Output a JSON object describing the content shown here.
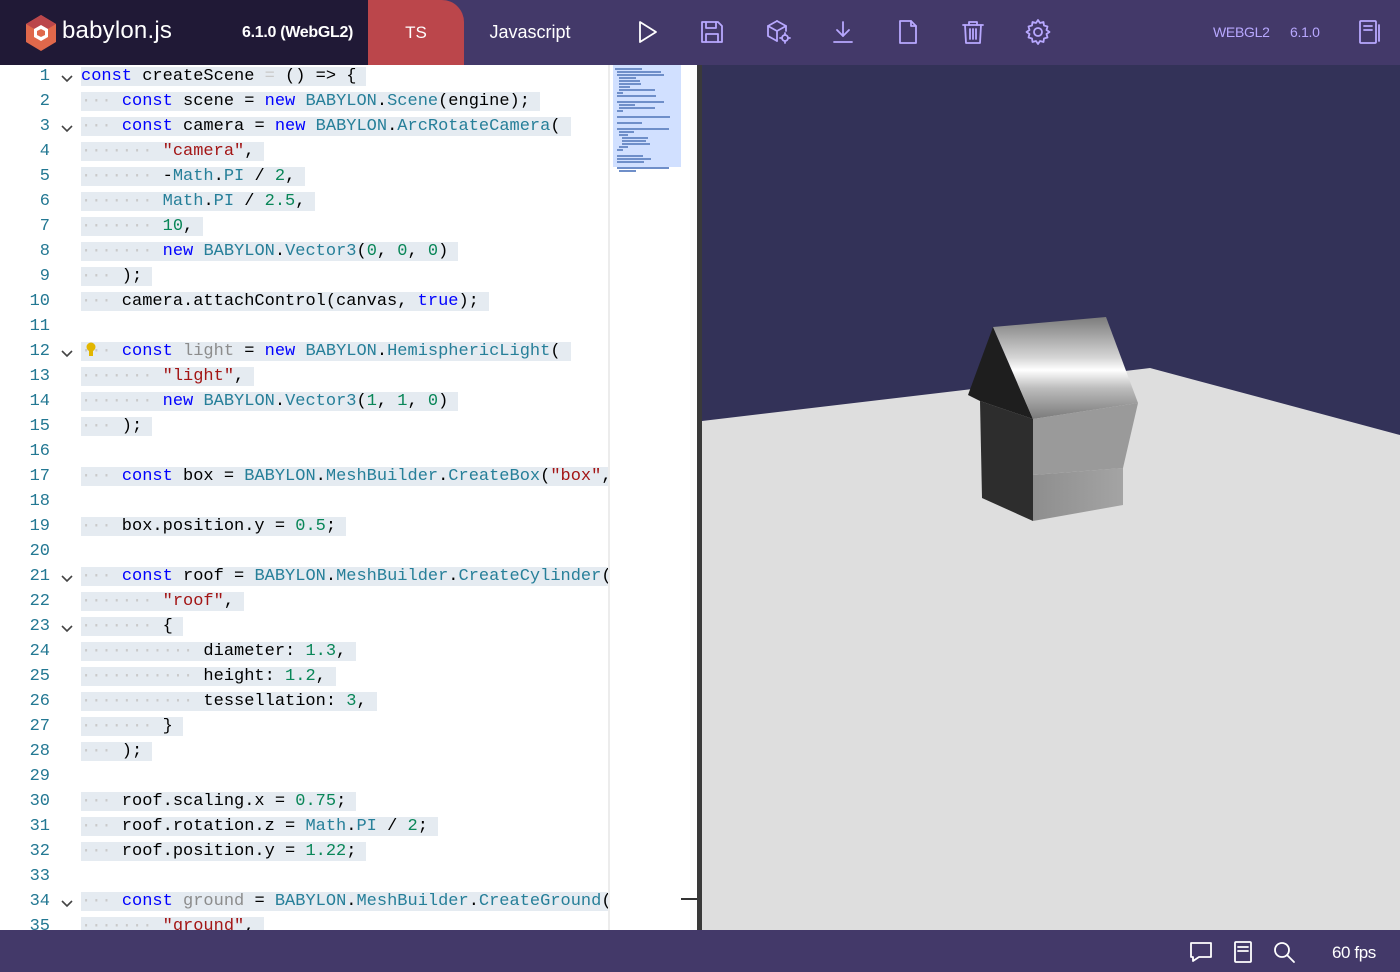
{
  "header": {
    "logo_text": "babylon.js",
    "version_label": "6.1.0 (WebGL2)",
    "tab_ts": "TS",
    "tab_js": "Javascript",
    "engine_label": "WEBGL2",
    "engine_version": "6.1.0",
    "icons": [
      "play-icon",
      "save-icon",
      "inspector-icon",
      "download-icon",
      "new-file-icon",
      "delete-icon",
      "settings-icon",
      "examples-icon"
    ]
  },
  "editor": {
    "line_numbers": [
      "1",
      "2",
      "3",
      "4",
      "5",
      "6",
      "7",
      "8",
      "9",
      "10",
      "11",
      "12",
      "13",
      "14",
      "15",
      "16",
      "17",
      "18",
      "19",
      "20",
      "21",
      "22",
      "23",
      "24",
      "25",
      "26",
      "27",
      "28",
      "29",
      "30",
      "31",
      "32",
      "33",
      "34",
      "35"
    ],
    "folded_lines": [
      1,
      3,
      12,
      21,
      23,
      34
    ],
    "lines": [
      [
        [
          "k",
          "const"
        ],
        [
          "p",
          " createScene "
        ],
        [
          "ws",
          "="
        ],
        [
          "p",
          " () => {"
        ]
      ],
      [
        [
          "ws",
          "···"
        ],
        [
          "p",
          " "
        ],
        [
          "k",
          "const"
        ],
        [
          "p",
          " scene = "
        ],
        [
          "k",
          "new"
        ],
        [
          "p",
          " "
        ],
        [
          "t",
          "BABYLON"
        ],
        [
          "p",
          "."
        ],
        [
          "t",
          "Scene"
        ],
        [
          "p",
          "(engine);"
        ]
      ],
      [
        [
          "ws",
          "···"
        ],
        [
          "p",
          " "
        ],
        [
          "k",
          "const"
        ],
        [
          "p",
          " camera = "
        ],
        [
          "k",
          "new"
        ],
        [
          "p",
          " "
        ],
        [
          "t",
          "BABYLON"
        ],
        [
          "p",
          "."
        ],
        [
          "t",
          "ArcRotateCamera"
        ],
        [
          "p",
          "("
        ]
      ],
      [
        [
          "ws",
          "·······"
        ],
        [
          "p",
          " "
        ],
        [
          "s",
          "\"camera\""
        ],
        [
          "p",
          ","
        ]
      ],
      [
        [
          "ws",
          "·······"
        ],
        [
          "p",
          " -"
        ],
        [
          "t",
          "Math"
        ],
        [
          "p",
          "."
        ],
        [
          "t",
          "PI"
        ],
        [
          "p",
          " / "
        ],
        [
          "n",
          "2"
        ],
        [
          "p",
          ","
        ]
      ],
      [
        [
          "ws",
          "·······"
        ],
        [
          "p",
          " "
        ],
        [
          "t",
          "Math"
        ],
        [
          "p",
          "."
        ],
        [
          "t",
          "PI"
        ],
        [
          "p",
          " / "
        ],
        [
          "n",
          "2.5"
        ],
        [
          "p",
          ","
        ]
      ],
      [
        [
          "ws",
          "·······"
        ],
        [
          "p",
          " "
        ],
        [
          "n",
          "10"
        ],
        [
          "p",
          ","
        ]
      ],
      [
        [
          "ws",
          "·······"
        ],
        [
          "p",
          " "
        ],
        [
          "k",
          "new"
        ],
        [
          "p",
          " "
        ],
        [
          "t",
          "BABYLON"
        ],
        [
          "p",
          "."
        ],
        [
          "t",
          "Vector3"
        ],
        [
          "p",
          "("
        ],
        [
          "n",
          "0"
        ],
        [
          "p",
          ", "
        ],
        [
          "n",
          "0"
        ],
        [
          "p",
          ", "
        ],
        [
          "n",
          "0"
        ],
        [
          "p",
          ")"
        ]
      ],
      [
        [
          "ws",
          "···"
        ],
        [
          "p",
          " );"
        ]
      ],
      [
        [
          "ws",
          "···"
        ],
        [
          "p",
          " camera.attachControl(canvas, "
        ],
        [
          "k",
          "true"
        ],
        [
          "p",
          ");"
        ]
      ],
      [],
      [
        [
          "ws",
          "···"
        ],
        [
          "p",
          " "
        ],
        [
          "k",
          "const"
        ],
        [
          "p",
          " "
        ],
        [
          "dim",
          "light"
        ],
        [
          "p",
          " = "
        ],
        [
          "k",
          "new"
        ],
        [
          "p",
          " "
        ],
        [
          "t",
          "BABYLON"
        ],
        [
          "p",
          "."
        ],
        [
          "t",
          "HemisphericLight"
        ],
        [
          "p",
          "("
        ]
      ],
      [
        [
          "ws",
          "·······"
        ],
        [
          "p",
          " "
        ],
        [
          "s",
          "\"light\""
        ],
        [
          "p",
          ","
        ]
      ],
      [
        [
          "ws",
          "·······"
        ],
        [
          "p",
          " "
        ],
        [
          "k",
          "new"
        ],
        [
          "p",
          " "
        ],
        [
          "t",
          "BABYLON"
        ],
        [
          "p",
          "."
        ],
        [
          "t",
          "Vector3"
        ],
        [
          "p",
          "("
        ],
        [
          "n",
          "1"
        ],
        [
          "p",
          ", "
        ],
        [
          "n",
          "1"
        ],
        [
          "p",
          ", "
        ],
        [
          "n",
          "0"
        ],
        [
          "p",
          ")"
        ]
      ],
      [
        [
          "ws",
          "···"
        ],
        [
          "p",
          " );"
        ]
      ],
      [],
      [
        [
          "ws",
          "···"
        ],
        [
          "p",
          " "
        ],
        [
          "k",
          "const"
        ],
        [
          "p",
          " box = "
        ],
        [
          "t",
          "BABYLON"
        ],
        [
          "p",
          "."
        ],
        [
          "t",
          "MeshBuilder"
        ],
        [
          "p",
          "."
        ],
        [
          "t",
          "CreateBox"
        ],
        [
          "p",
          "("
        ],
        [
          "s",
          "\"box\""
        ],
        [
          "p",
          ", "
        ]
      ],
      [],
      [
        [
          "ws",
          "···"
        ],
        [
          "p",
          " box.position.y = "
        ],
        [
          "n",
          "0.5"
        ],
        [
          "p",
          ";"
        ]
      ],
      [],
      [
        [
          "ws",
          "···"
        ],
        [
          "p",
          " "
        ],
        [
          "k",
          "const"
        ],
        [
          "p",
          " roof = "
        ],
        [
          "t",
          "BABYLON"
        ],
        [
          "p",
          "."
        ],
        [
          "t",
          "MeshBuilder"
        ],
        [
          "p",
          "."
        ],
        [
          "t",
          "CreateCylinder"
        ],
        [
          "p",
          "("
        ]
      ],
      [
        [
          "ws",
          "·······"
        ],
        [
          "p",
          " "
        ],
        [
          "s",
          "\"roof\""
        ],
        [
          "p",
          ","
        ]
      ],
      [
        [
          "ws",
          "·······"
        ],
        [
          "p",
          " {"
        ]
      ],
      [
        [
          "ws",
          "···········"
        ],
        [
          "p",
          " diameter: "
        ],
        [
          "n",
          "1.3"
        ],
        [
          "p",
          ","
        ]
      ],
      [
        [
          "ws",
          "···········"
        ],
        [
          "p",
          " height: "
        ],
        [
          "n",
          "1.2"
        ],
        [
          "p",
          ","
        ]
      ],
      [
        [
          "ws",
          "···········"
        ],
        [
          "p",
          " tessellation: "
        ],
        [
          "n",
          "3"
        ],
        [
          "p",
          ","
        ]
      ],
      [
        [
          "ws",
          "·······"
        ],
        [
          "p",
          " }"
        ]
      ],
      [
        [
          "ws",
          "···"
        ],
        [
          "p",
          " );"
        ]
      ],
      [],
      [
        [
          "ws",
          "···"
        ],
        [
          "p",
          " roof.scaling.x = "
        ],
        [
          "n",
          "0.75"
        ],
        [
          "p",
          ";"
        ]
      ],
      [
        [
          "ws",
          "···"
        ],
        [
          "p",
          " roof.rotation.z = "
        ],
        [
          "t",
          "Math"
        ],
        [
          "p",
          "."
        ],
        [
          "t",
          "PI"
        ],
        [
          "p",
          " / "
        ],
        [
          "n",
          "2"
        ],
        [
          "p",
          ";"
        ]
      ],
      [
        [
          "ws",
          "···"
        ],
        [
          "p",
          " roof.position.y = "
        ],
        [
          "n",
          "1.22"
        ],
        [
          "p",
          ";"
        ]
      ],
      [],
      [
        [
          "ws",
          "···"
        ],
        [
          "p",
          " "
        ],
        [
          "k",
          "const"
        ],
        [
          "p",
          " "
        ],
        [
          "dim",
          "ground"
        ],
        [
          "p",
          " = "
        ],
        [
          "t",
          "BABYLON"
        ],
        [
          "p",
          "."
        ],
        [
          "t",
          "MeshBuilder"
        ],
        [
          "p",
          "."
        ],
        [
          "t",
          "CreateGround"
        ],
        [
          "p",
          "("
        ]
      ],
      [
        [
          "ws",
          "·······"
        ],
        [
          "p",
          " "
        ],
        [
          "s",
          "\"ground\""
        ],
        [
          "p",
          ","
        ]
      ]
    ]
  },
  "footer": {
    "icons": [
      "comment-icon",
      "docs-icon",
      "search-icon"
    ],
    "fps": "60 fps"
  },
  "colors": {
    "header_bg": "#433969",
    "logo_bg": "#201936",
    "ts_tab": "#bb464b",
    "icon_accent": "#b8a8ff",
    "render_bg": "#333258",
    "ground": "#dedede"
  }
}
